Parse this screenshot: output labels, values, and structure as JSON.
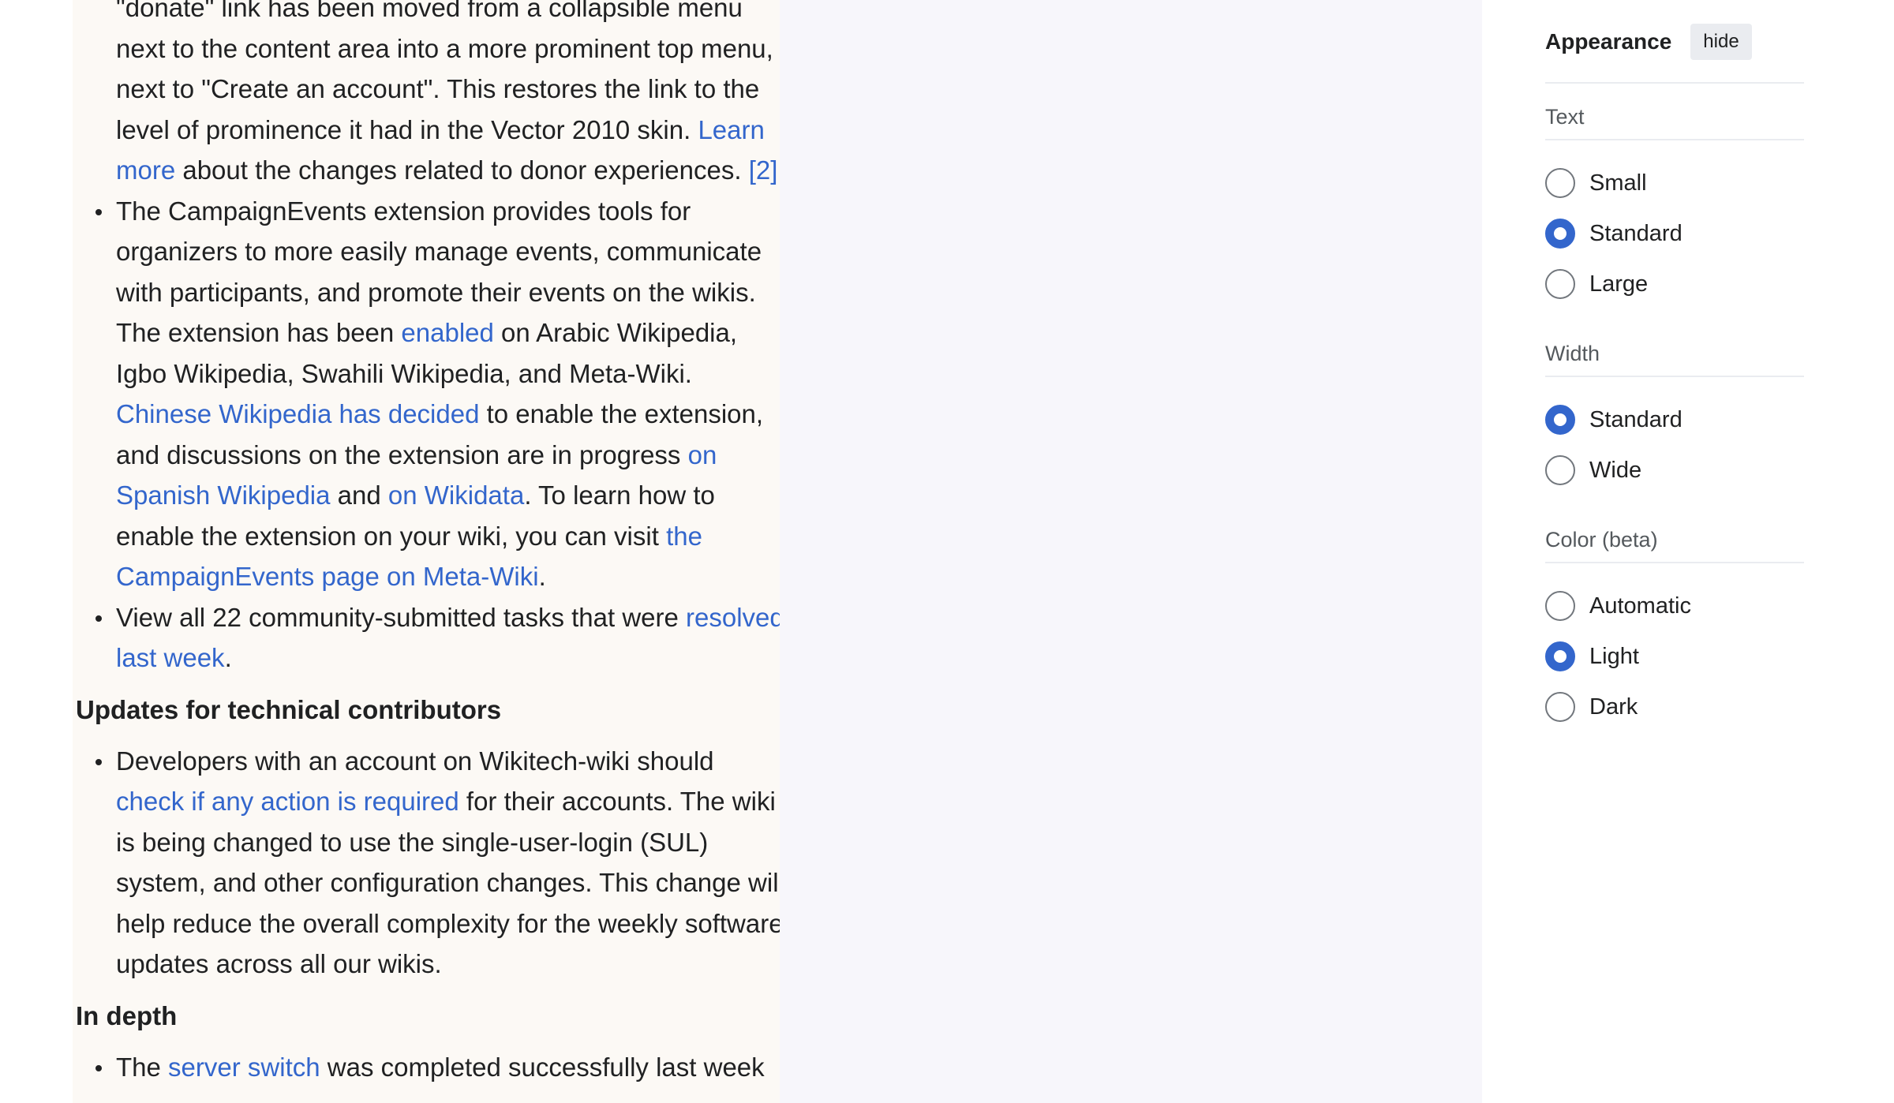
{
  "article": {
    "donate_item": {
      "part1": "\"donate\" link has been moved from a collapsible menu next to the content area into a more prominent top menu, next to \"Create an account\". This restores the link to the level of prominence it had in the Vector 2010 skin. ",
      "link_learn_more": "Learn more",
      "part2": " about the changes related to donor experiences. ",
      "ref": "[2]"
    },
    "campaign_item": {
      "part1": "The CampaignEvents extension provides tools for organizers to more easily manage events, communicate with participants, and promote their events on the wikis. The extension has been ",
      "link_enabled": "enabled",
      "part2": " on Arabic Wikipedia, Igbo Wikipedia, Swahili Wikipedia, and Meta-Wiki. ",
      "link_chinese": "Chinese Wikipedia has decided",
      "part3": " to enable the extension, and discussions on the extension are in progress ",
      "link_spanish": "on Spanish Wikipedia",
      "part4": " and ",
      "link_wikidata": "on Wikidata",
      "part5": ". To learn how to enable the extension on your wiki, you can visit ",
      "link_page": "the CampaignEvents page on Meta-Wiki",
      "part6": "."
    },
    "tasks_item": {
      "part1": "View all 22 community-submitted tasks that were ",
      "link_resolved": "resolved last week",
      "part2": "."
    },
    "heading_technical": "Updates for technical contributors",
    "developers_item": {
      "part1": "Developers with an account on Wikitech-wiki should ",
      "link_check": "check if any action is required",
      "part2": " for their accounts. The wiki is being changed to use the single-user-login (SUL) system, and other configuration changes. This change will help reduce the overall complexity for the weekly software updates across all our wikis."
    },
    "heading_depth": "In depth",
    "server_item": {
      "part1": "The ",
      "link_server": "server switch",
      "part2": " was completed successfully last week"
    }
  },
  "appearance": {
    "title": "Appearance",
    "hide_label": "hide",
    "text": {
      "label": "Text",
      "options": [
        "Small",
        "Standard",
        "Large"
      ],
      "selected": "Standard"
    },
    "width": {
      "label": "Width",
      "options": [
        "Standard",
        "Wide"
      ],
      "selected": "Standard"
    },
    "color": {
      "label": "Color (beta)",
      "options": [
        "Automatic",
        "Light",
        "Dark"
      ],
      "selected": "Light"
    }
  },
  "colors": {
    "link": "#3366cc",
    "radio_selected": "#3366cc",
    "article_bg": "#fcf9f5",
    "panel_bg": "#f7f6fb"
  }
}
